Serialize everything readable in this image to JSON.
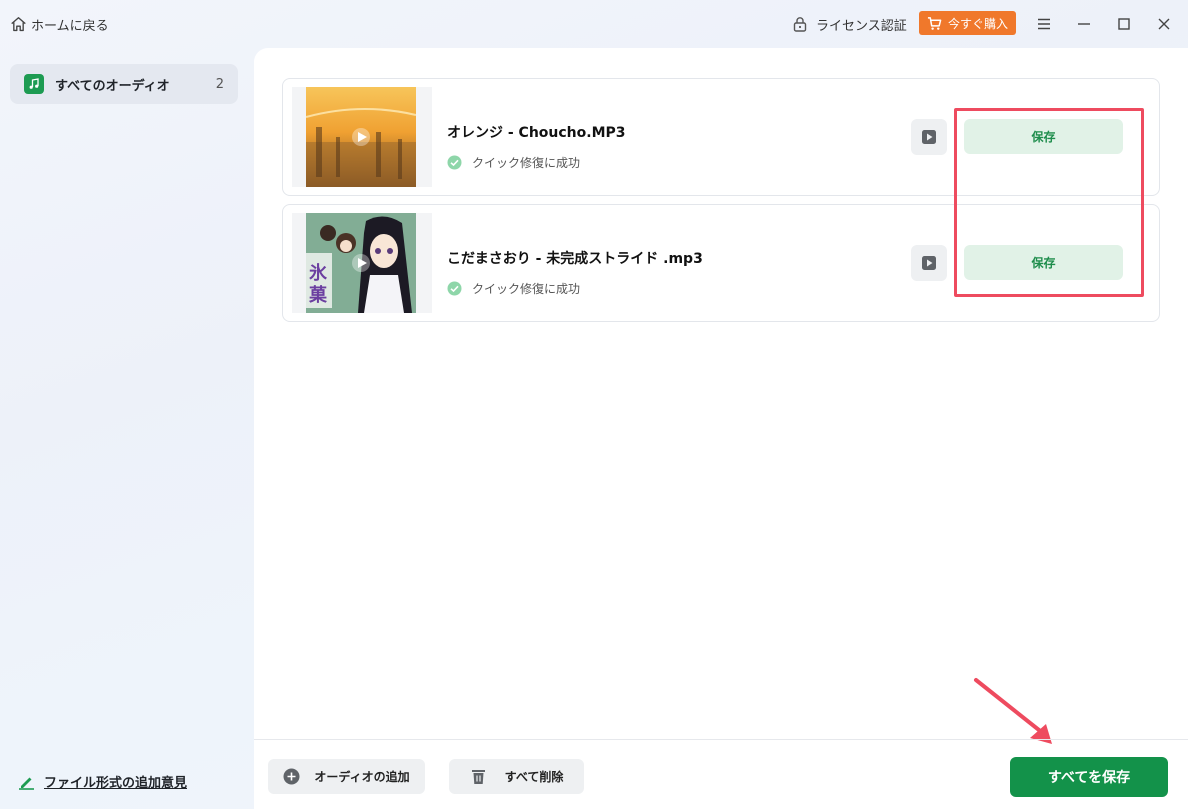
{
  "titlebar": {
    "home_label": "ホームに戻る",
    "license_label": "ライセンス認証",
    "buy_label": "今すぐ購入"
  },
  "sidebar": {
    "items": [
      {
        "label": "すべてのオーディオ",
        "count": "2",
        "icon": "music-note-icon"
      }
    ],
    "feedback_label": "ファイル形式の追加意見"
  },
  "files": [
    {
      "title": "オレンジ - Choucho.MP3",
      "status": "クイック修復に成功",
      "save_label": "保存"
    },
    {
      "title": "こだまさおり - 未完成ストライド .mp3",
      "status": "クイック修復に成功",
      "save_label": "保存"
    }
  ],
  "bottom": {
    "add_label": "オーディオの追加",
    "delete_label": "すべて削除",
    "save_all_label": "すべてを保存"
  },
  "colors": {
    "accent": "#13924a",
    "buy": "#f0782b",
    "highlight": "#ee4b5f",
    "save_bg": "#e1f2e7"
  }
}
